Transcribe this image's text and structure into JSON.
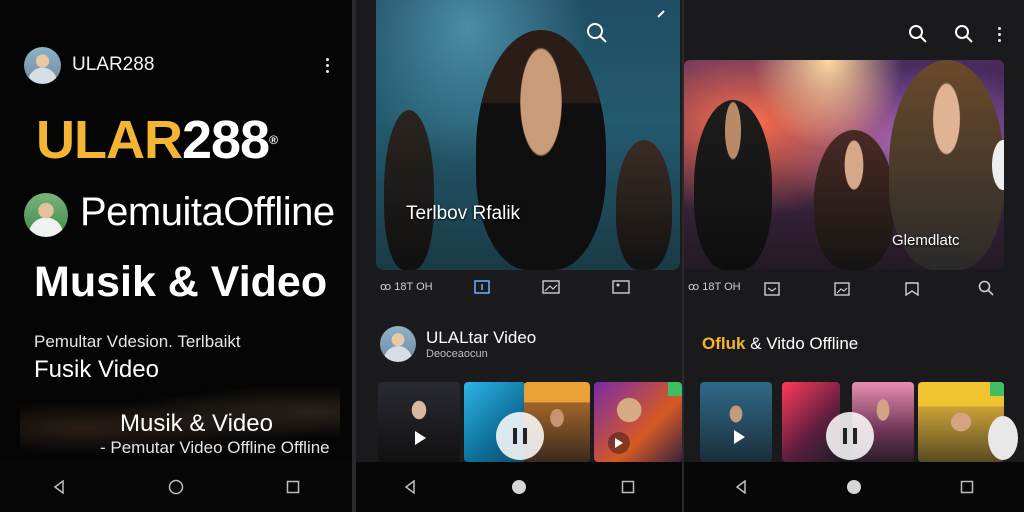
{
  "panel1": {
    "brand": "ULAR288",
    "logo_part1": "ULAR",
    "logo_part2": "288",
    "logo_mark": "®",
    "headline": "PemuitaOffline",
    "title": "Musik & Video",
    "subtitle": "Pemultar Vdesion. Terlbaikt",
    "subtitle2": "Fusik Video",
    "caption": "Musik & Video",
    "caption2": "- Pemutar Video Offline Offline"
  },
  "panel2": {
    "hero_text": "Terlbov Rfalik",
    "tab_label": "ꝏ 18T OH",
    "channel_name": "ULALtar Video",
    "channel_sub": "Deoceaocun"
  },
  "panel3": {
    "hero_text": "Glemdlatc",
    "tab_label": "ꝏ 18T OH",
    "heading_part1": "Ofluk",
    "heading_part2": "& Vitdo Offline"
  },
  "colors": {
    "accent_yellow": "#f4b533",
    "background": "#050505"
  },
  "icons": [
    "search-icon",
    "kebab-menu-icon",
    "pause-icon",
    "play-icon",
    "back-nav-icon",
    "home-nav-icon",
    "recents-nav-icon"
  ]
}
